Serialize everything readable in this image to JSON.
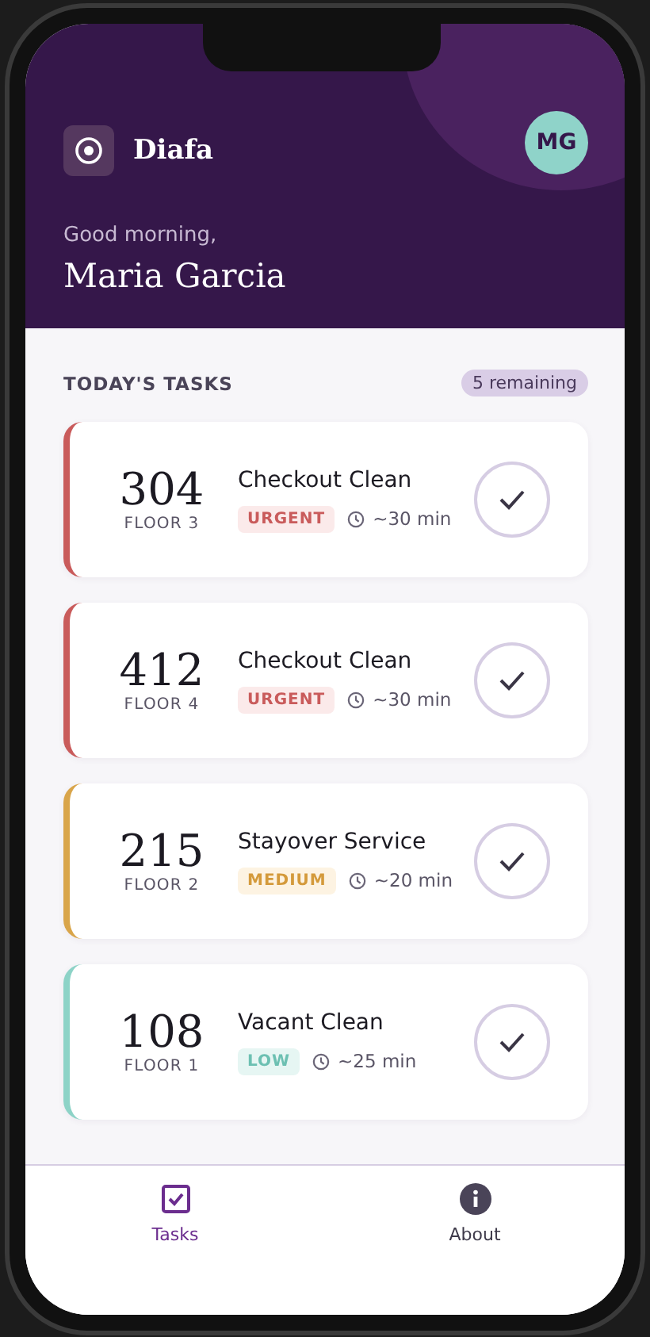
{
  "app": {
    "name": "Diafa"
  },
  "user": {
    "initials": "MG",
    "greeting": "Good morning,",
    "name": "Maria Garcia"
  },
  "section": {
    "title": "TODAY'S TASKS",
    "badge": "5 remaining"
  },
  "tasks": [
    {
      "room": "304",
      "floor": "FLOOR 3",
      "title": "Checkout Clean",
      "priority": "URGENT",
      "kind": "urgent",
      "color": "#c95b5b",
      "time": "~30 min"
    },
    {
      "room": "412",
      "floor": "FLOOR 4",
      "title": "Checkout Clean",
      "priority": "URGENT",
      "kind": "urgent",
      "color": "#c95b5b",
      "time": "~30 min"
    },
    {
      "room": "215",
      "floor": "FLOOR 2",
      "title": "Stayover Service",
      "priority": "MEDIUM",
      "kind": "medium",
      "color": "#d9a54a",
      "time": "~20 min"
    },
    {
      "room": "108",
      "floor": "FLOOR 1",
      "title": "Vacant Clean",
      "priority": "LOW",
      "kind": "low",
      "color": "#8dd3c7",
      "time": "~25 min"
    }
  ],
  "nav": [
    {
      "label": "Tasks",
      "kind": "tasks",
      "selected": true
    },
    {
      "label": "About",
      "kind": "about",
      "selected": false
    }
  ]
}
